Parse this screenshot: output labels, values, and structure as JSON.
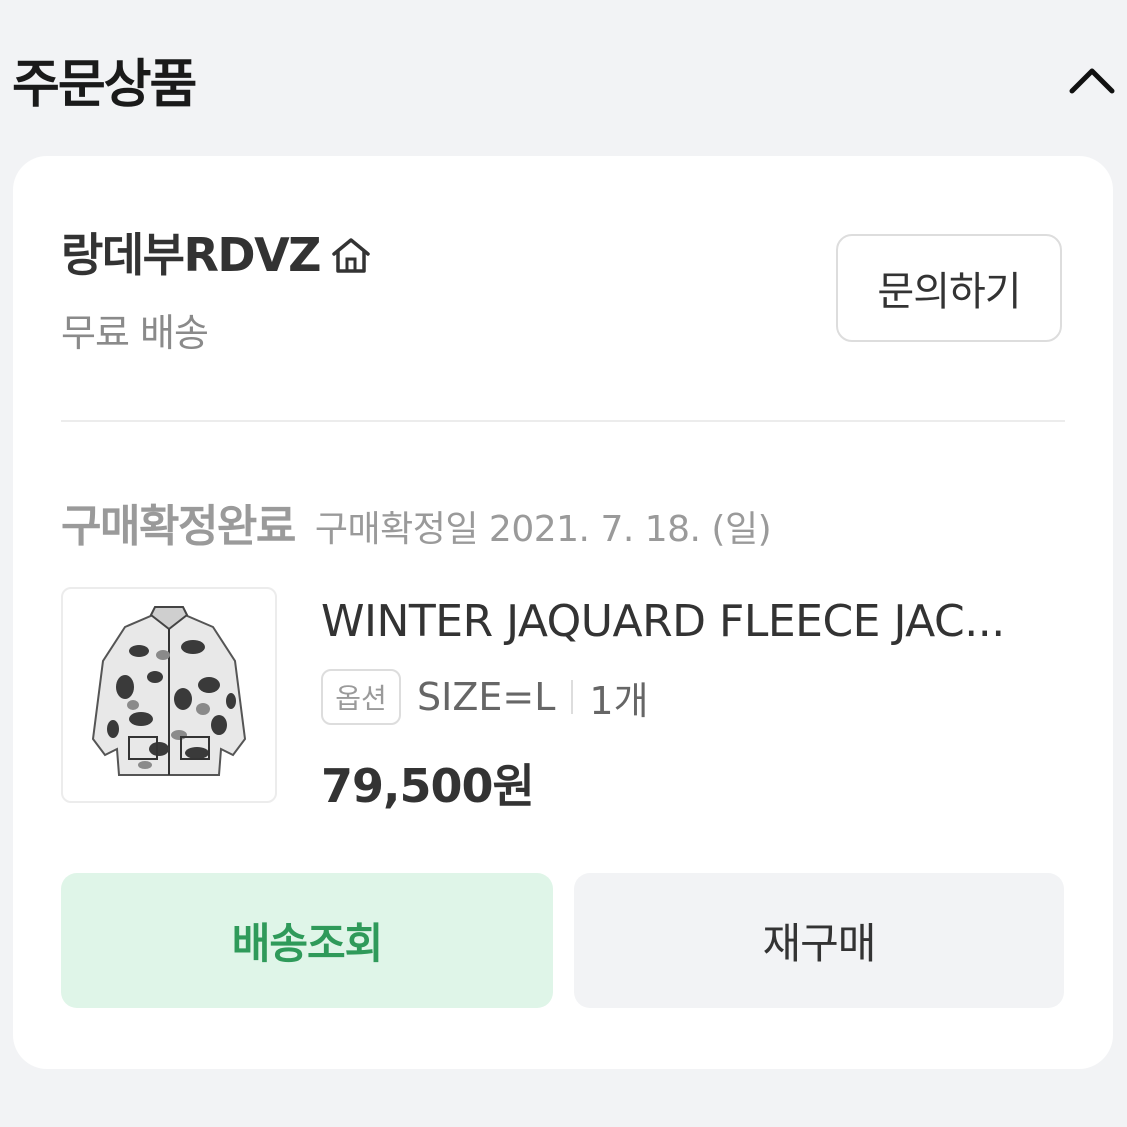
{
  "header": {
    "title": "주문상품",
    "collapse_icon": "chevron-up-icon"
  },
  "order": {
    "shop": {
      "name": "랑데부RDVZ",
      "home_icon": "home-icon",
      "shipping": "무료 배송"
    },
    "inquiry_label": "문의하기",
    "status": {
      "label": "구매확정완료",
      "date_text": "구매확정일 2021. 7. 18. (일)"
    },
    "product": {
      "image": "fleece-jacket-thumbnail",
      "name": "WINTER JAQUARD FLEECE JAC...",
      "option_badge": "옵션",
      "option_value": "SIZE=L",
      "quantity": "1개",
      "price": "79,500원"
    },
    "actions": {
      "track_label": "배송조회",
      "rebuy_label": "재구매"
    }
  },
  "colors": {
    "background": "#f2f3f5",
    "card": "#ffffff",
    "track_button_bg": "#dff5e8",
    "track_button_text": "#2f9a5a",
    "muted_text": "#9a9a9a"
  }
}
